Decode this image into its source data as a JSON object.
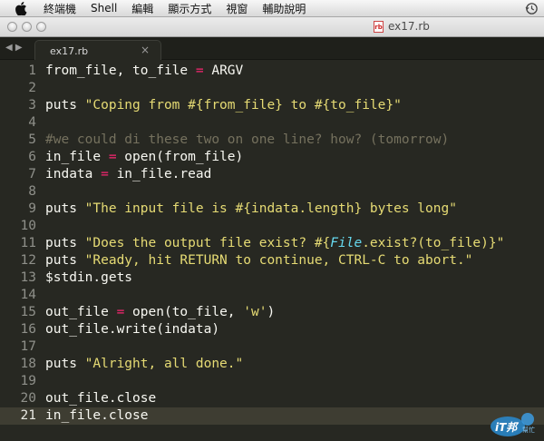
{
  "menubar": {
    "items": [
      "終端機",
      "Shell",
      "編輯",
      "顯示方式",
      "視窗",
      "輔助說明"
    ]
  },
  "window": {
    "title": "ex17.rb",
    "file_icon_text": "rb"
  },
  "tabbar": {
    "arrows": "◀ ▶",
    "tab_label": "ex17.rb",
    "close_glyph": "×"
  },
  "editor": {
    "current_line": 21,
    "lines": [
      [
        {
          "t": "from_file, to_file "
        },
        {
          "t": "=",
          "c": "kw"
        },
        {
          "t": " ARGV"
        }
      ],
      [],
      [
        {
          "t": "puts "
        },
        {
          "t": "\"Coping from #{from_file} to #{to_file}\"",
          "c": "st"
        }
      ],
      [],
      [
        {
          "t": "#we could di these two on one line? how? (tomorrow)",
          "c": "cm"
        }
      ],
      [
        {
          "t": "in_file "
        },
        {
          "t": "=",
          "c": "kw"
        },
        {
          "t": " open(from_file)"
        }
      ],
      [
        {
          "t": "indata "
        },
        {
          "t": "=",
          "c": "kw"
        },
        {
          "t": " in_file.read"
        }
      ],
      [],
      [
        {
          "t": "puts "
        },
        {
          "t": "\"The input file is #{indata.length} bytes long\"",
          "c": "st"
        }
      ],
      [],
      [
        {
          "t": "puts "
        },
        {
          "t": "\"Does the output file exist? #{",
          "c": "st"
        },
        {
          "t": "File",
          "c": "cls"
        },
        {
          "t": ".exist?(to_file)}\"",
          "c": "st"
        }
      ],
      [
        {
          "t": "puts "
        },
        {
          "t": "\"Ready, hit RETURN to continue, CTRL-C to abort.\"",
          "c": "st"
        }
      ],
      [
        {
          "t": "$stdin.gets"
        }
      ],
      [],
      [
        {
          "t": "out_file "
        },
        {
          "t": "=",
          "c": "kw"
        },
        {
          "t": " open(to_file, "
        },
        {
          "t": "'w'",
          "c": "st"
        },
        {
          "t": ")"
        }
      ],
      [
        {
          "t": "out_file.write(indata)"
        }
      ],
      [],
      [
        {
          "t": "puts "
        },
        {
          "t": "\"Alright, all done.\"",
          "c": "st"
        }
      ],
      [],
      [
        {
          "t": "out_file.close"
        }
      ],
      [
        {
          "t": "in_file.close"
        }
      ]
    ]
  },
  "watermark": {
    "text": "iT邦",
    "sub": "幫忙"
  },
  "colors": {
    "background": "#272822",
    "default_text": "#f8f8f2",
    "comment": "#75715e",
    "string": "#e6db74",
    "keyword": "#f92672",
    "class": "#66d9ef",
    "current_line": "#3e3d32"
  }
}
